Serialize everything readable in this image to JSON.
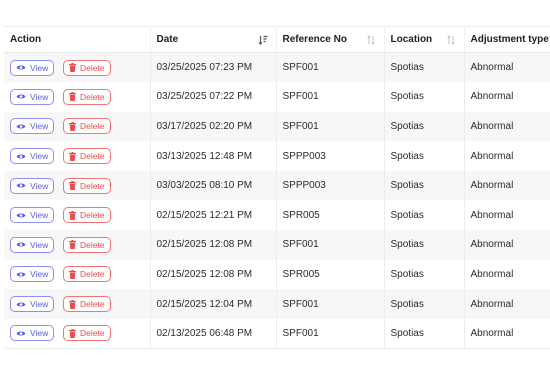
{
  "columns": [
    {
      "label": "Action",
      "sortable": false
    },
    {
      "label": "Date",
      "sortable": true,
      "sort_state": "desc"
    },
    {
      "label": "Reference No",
      "sortable": true,
      "sort_state": "none"
    },
    {
      "label": "Location",
      "sortable": true,
      "sort_state": "none"
    },
    {
      "label": "Adjustment type",
      "sortable": false
    }
  ],
  "buttons": {
    "view_label": "View",
    "delete_label": "Delete"
  },
  "rows": [
    {
      "date": "03/25/2025 07:23 PM",
      "reference": "SPF001",
      "location": "Spotias",
      "adjustment_type": "Abnormal"
    },
    {
      "date": "03/25/2025 07:22 PM",
      "reference": "SPF001",
      "location": "Spotias",
      "adjustment_type": "Abnormal"
    },
    {
      "date": "03/17/2025 02:20 PM",
      "reference": "SPF001",
      "location": "Spotias",
      "adjustment_type": "Abnormal"
    },
    {
      "date": "03/13/2025 12:48 PM",
      "reference": "SPPP003",
      "location": "Spotias",
      "adjustment_type": "Abnormal"
    },
    {
      "date": "03/03/2025 08:10 PM",
      "reference": "SPPP003",
      "location": "Spotias",
      "adjustment_type": "Abnormal"
    },
    {
      "date": "02/15/2025 12:21 PM",
      "reference": "SPR005",
      "location": "Spotias",
      "adjustment_type": "Abnormal"
    },
    {
      "date": "02/15/2025 12:08 PM",
      "reference": "SPF001",
      "location": "Spotias",
      "adjustment_type": "Abnormal"
    },
    {
      "date": "02/15/2025 12:08 PM",
      "reference": "SPR005",
      "location": "Spotias",
      "adjustment_type": "Abnormal"
    },
    {
      "date": "02/15/2025 12:04 PM",
      "reference": "SPF001",
      "location": "Spotias",
      "adjustment_type": "Abnormal"
    },
    {
      "date": "02/13/2025 06:48 PM",
      "reference": "SPF001",
      "location": "Spotias",
      "adjustment_type": "Abnormal"
    }
  ],
  "colors": {
    "view": "#5a60e6",
    "delete": "#ec4b4b",
    "row_stripe": "#f7f7f8"
  },
  "icons": {
    "view": "eye-icon",
    "delete": "trash-icon",
    "sort_active": "sort-descending-icon",
    "sort_idle": "sort-icon"
  }
}
